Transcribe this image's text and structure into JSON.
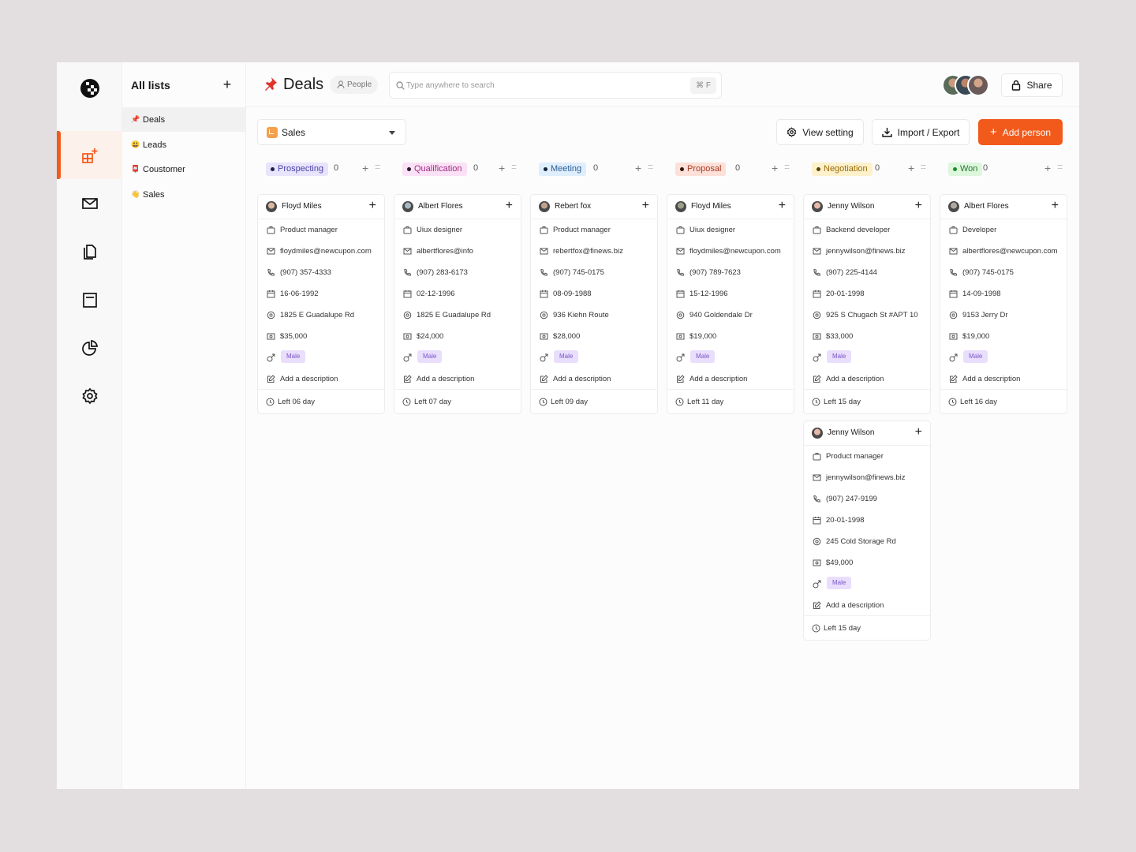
{
  "rail": {
    "items": [
      "dashboard-icon",
      "mail-icon",
      "documents-icon",
      "notes-icon",
      "reports-icon",
      "settings-icon"
    ],
    "active": 0,
    "accent": "#f25a1c"
  },
  "lists": {
    "title": "All lists",
    "items": [
      {
        "emoji": "📌",
        "label": "Deals"
      },
      {
        "emoji": "😃",
        "label": "Leads"
      },
      {
        "emoji": "📮",
        "label": "Coustomer"
      },
      {
        "emoji": "👋",
        "label": "Sales"
      }
    ]
  },
  "header": {
    "title": "Deals",
    "people_tag": "People",
    "search_placeholder": "Type anywhere to search",
    "shortcut": "⌘ F",
    "share": "Share"
  },
  "toolbar": {
    "pipeline": "Sales",
    "view_setting": "View setting",
    "import_export": "Import / Export",
    "add_person": "Add person"
  },
  "columns": [
    {
      "stage": "Prospecting",
      "count": "0",
      "bg": "#e7e4fc",
      "fg": "#4b3fa8",
      "dot": "#1f1f4d",
      "cards": [
        {
          "name": "Floyd Miles",
          "role": "Product manager",
          "email": "floydmiles@newcupon.com",
          "phone": "(907) 357-4333",
          "date": "16-06-1992",
          "address": "1825 E Guadalupe Rd",
          "amount": "$35,000",
          "gender": "Male",
          "description": "Add a description",
          "left": "Left 06 day"
        }
      ]
    },
    {
      "stage": "Qualification",
      "count": "0",
      "bg": "#fbe1f5",
      "fg": "#a02a86",
      "dot": "#2a1a26",
      "cards": [
        {
          "name": "Albert Flores",
          "role": "Uiux designer",
          "email": "albertflores@info",
          "phone": "(907) 283-6173",
          "date": "02-12-1996",
          "address": "1825 E Guadalupe Rd",
          "amount": "$24,000",
          "gender": "Male",
          "description": "Add a description",
          "left": "Left 07 day"
        }
      ]
    },
    {
      "stage": "Meeting",
      "count": "0",
      "bg": "#dfeefc",
      "fg": "#2c5f94",
      "dot": "#12243a",
      "cards": [
        {
          "name": "Rebert fox",
          "role": "Product manager",
          "email": "rebertfox@finews.biz",
          "phone": "(907) 745-0175",
          "date": "08-09-1988",
          "address": "936 Kiehn Route",
          "amount": "$28,000",
          "gender": "Male",
          "description": "Add a description",
          "left": "Left 09 day"
        }
      ]
    },
    {
      "stage": "Proposal",
      "count": "0",
      "bg": "#fde0d8",
      "fg": "#a63b20",
      "dot": "#2e1812",
      "cards": [
        {
          "name": "Floyd Miles",
          "role": "Uiux designer",
          "email": "floydmiles@newcupon.com",
          "phone": "(907) 789-7623",
          "date": "15-12-1996",
          "address": "940 Goldendale Dr",
          "amount": "$19,000",
          "gender": "Male",
          "description": "Add a description",
          "left": "Left 11 day"
        }
      ]
    },
    {
      "stage": "Negotiation",
      "count": "0",
      "bg": "#fdf1cc",
      "fg": "#9a6b08",
      "dot": "#5a4206",
      "cards": [
        {
          "name": "Jenny Wilson",
          "role": "Backend developer",
          "email": "jennywilson@finews.biz",
          "phone": "(907) 225-4144",
          "date": "20-01-1998",
          "address": "925 S Chugach St #APT 10",
          "amount": "$33,000",
          "gender": "Male",
          "description": "Add a description",
          "left": "Left 15 day"
        },
        {
          "name": "Jenny Wilson",
          "role": "Product manager",
          "email": "jennywilson@finews.biz",
          "phone": "(907) 247-9199",
          "date": "20-01-1998",
          "address": "245 Cold Storage Rd",
          "amount": "$49,000",
          "gender": "Male",
          "description": "Add a description",
          "left": "Left 15 day"
        }
      ]
    },
    {
      "stage": "Won",
      "count": "0",
      "bg": "#dcf7dc",
      "fg": "#237a2c",
      "dot": "#1d8a26",
      "cards": [
        {
          "name": "Albert Flores",
          "role": "Developer",
          "email": "albertflores@newcupon.com",
          "phone": "(907) 745-0175",
          "date": "14-09-1998",
          "address": "9153 Jerry Dr",
          "amount": "$19,000",
          "gender": "Male",
          "description": "Add a description",
          "left": "Left 16 day"
        }
      ]
    }
  ]
}
